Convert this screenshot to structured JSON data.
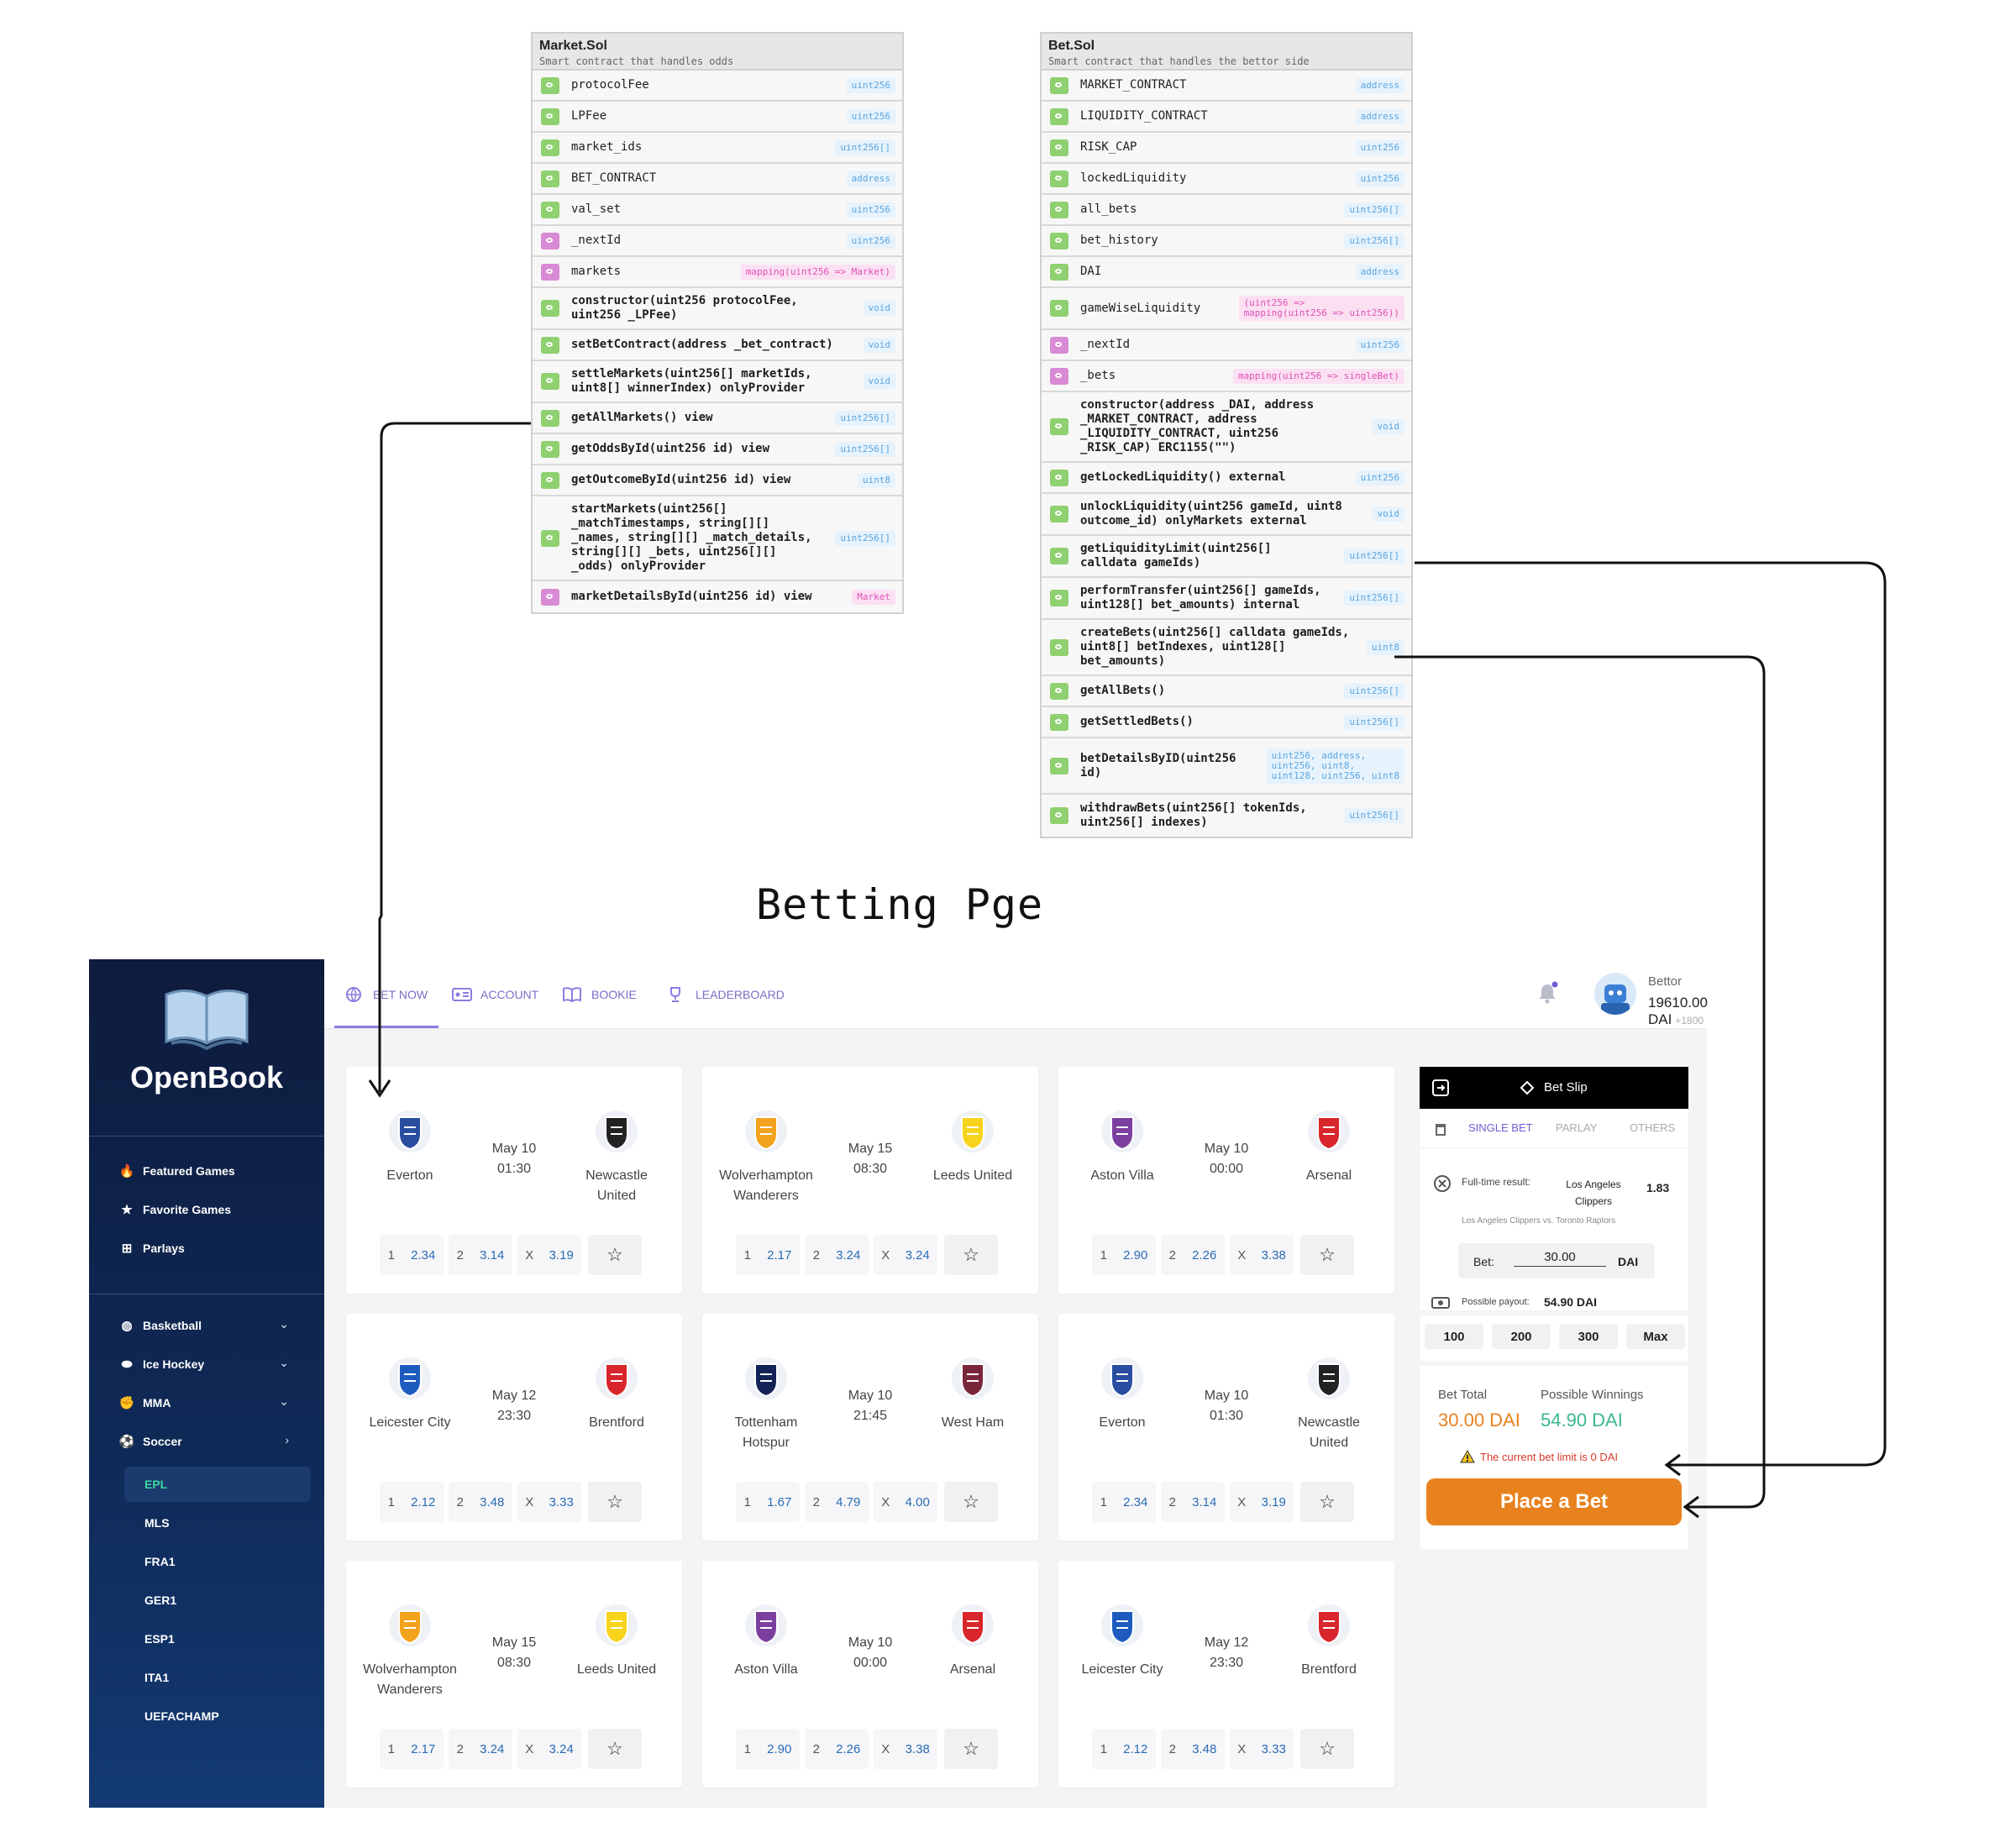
{
  "market_contract": {
    "title": "Market.Sol",
    "subtitle": "Smart contract that handles odds",
    "rows": [
      {
        "name": "protocolFee",
        "type": "uint256",
        "vis": "pub",
        "fn": false
      },
      {
        "name": "LPFee",
        "type": "uint256",
        "vis": "pub",
        "fn": false
      },
      {
        "name": "market_ids",
        "type": "uint256[]",
        "vis": "pub",
        "fn": false
      },
      {
        "name": "BET_CONTRACT",
        "type": "address",
        "vis": "pub",
        "fn": false
      },
      {
        "name": "val_set",
        "type": "uint256",
        "vis": "pub",
        "fn": false
      },
      {
        "name": "_nextId",
        "type": "uint256",
        "vis": "priv",
        "fn": false
      },
      {
        "name": "markets",
        "type": "mapping(uint256 => Market)",
        "vis": "priv",
        "fn": false,
        "map": true
      },
      {
        "name": "constructor(uint256 protocolFee,\nuint256 _LPFee)",
        "type": "void",
        "vis": "pub",
        "fn": true
      },
      {
        "name": "setBetContract(address _bet_contract)",
        "type": "void",
        "vis": "pub",
        "fn": true
      },
      {
        "name": "settleMarkets(uint256[] marketIds,\nuint8[] winnerIndex) onlyProvider",
        "type": "void",
        "vis": "pub",
        "fn": true
      },
      {
        "name": "getAllMarkets() view",
        "type": "uint256[]",
        "vis": "pub",
        "fn": true
      },
      {
        "name": "getOddsById(uint256 id) view",
        "type": "uint256[]",
        "vis": "pub",
        "fn": true
      },
      {
        "name": "getOutcomeById(uint256 id) view",
        "type": "uint8",
        "vis": "pub",
        "fn": true
      },
      {
        "name": "startMarkets(uint256[]\n_matchTimestamps, string[][]\n_names, string[][] _match_details,\nstring[][] _bets, uint256[][]\n_odds) onlyProvider",
        "type": "uint256[]",
        "vis": "pub",
        "fn": true
      },
      {
        "name": "marketDetailsById(uint256 id) view",
        "type": "Market",
        "vis": "priv",
        "fn": true,
        "map": true
      }
    ]
  },
  "bet_contract": {
    "title": "Bet.Sol",
    "subtitle": "Smart contract that handles the bettor side",
    "rows": [
      {
        "name": "MARKET_CONTRACT",
        "type": "address",
        "vis": "pub",
        "fn": false
      },
      {
        "name": "LIQUIDITY_CONTRACT",
        "type": "address",
        "vis": "pub",
        "fn": false
      },
      {
        "name": "RISK_CAP",
        "type": "uint256",
        "vis": "pub",
        "fn": false
      },
      {
        "name": "lockedLiquidity",
        "type": "uint256",
        "vis": "pub",
        "fn": false
      },
      {
        "name": "all_bets",
        "type": "uint256[]",
        "vis": "pub",
        "fn": false
      },
      {
        "name": "bet_history",
        "type": "uint256[]",
        "vis": "pub",
        "fn": false
      },
      {
        "name": "DAI",
        "type": "address",
        "vis": "pub",
        "fn": false
      },
      {
        "name": "gameWiseLiquidity",
        "type": "(uint256 =>\nmapping(uint256 => uint256))",
        "vis": "pub",
        "fn": false,
        "map": true
      },
      {
        "name": "_nextId",
        "type": "uint256",
        "vis": "priv",
        "fn": false
      },
      {
        "name": "_bets",
        "type": "mapping(uint256 => singleBet)",
        "vis": "priv",
        "fn": false,
        "map": true
      },
      {
        "name": "constructor(address _DAI, address\n_MARKET_CONTRACT, address\n_LIQUIDITY_CONTRACT, uint256\n_RISK_CAP) ERC1155(\"\")",
        "type": "void",
        "vis": "pub",
        "fn": true
      },
      {
        "name": "getLockedLiquidity() external",
        "type": "uint256",
        "vis": "pub",
        "fn": true
      },
      {
        "name": "unlockLiquidity(uint256 gameId, uint8\noutcome_id) onlyMarkets external",
        "type": "void",
        "vis": "pub",
        "fn": true
      },
      {
        "name": "getLiquidityLimit(uint256[]\ncalldata gameIds)",
        "type": "uint256[]",
        "vis": "pub",
        "fn": true
      },
      {
        "name": "performTransfer(uint256[] gameIds,\nuint128[] bet_amounts) internal",
        "type": "uint256[]",
        "vis": "pub",
        "fn": true
      },
      {
        "name": "createBets(uint256[] calldata gameIds,\nuint8[] betIndexes, uint128[]\nbet_amounts)",
        "type": "uint8",
        "vis": "pub",
        "fn": true
      },
      {
        "name": "getAllBets()",
        "type": "uint256[]",
        "vis": "pub",
        "fn": true
      },
      {
        "name": "getSettledBets()",
        "type": "uint256[]",
        "vis": "pub",
        "fn": true
      },
      {
        "name": "betDetailsByID(uint256\nid)",
        "type": "uint256, address,\nuint256, uint8,\nuint128, uint256, uint8",
        "vis": "pub",
        "fn": true
      },
      {
        "name": "withdrawBets(uint256[] tokenIds,\nuint256[] indexes)",
        "type": "uint256[]",
        "vis": "pub",
        "fn": true
      }
    ]
  },
  "page_title": "Betting Pge",
  "app": {
    "brand": "OpenBook",
    "sidebar": {
      "top_items": [
        {
          "label": "Featured Games",
          "icon": "flame-icon"
        },
        {
          "label": "Favorite Games",
          "icon": "star-icon"
        },
        {
          "label": "Parlays",
          "icon": "grid-icon"
        }
      ],
      "sports": [
        {
          "label": "Basketball",
          "icon": "basketball-icon",
          "chevron": "⌄"
        },
        {
          "label": "Ice Hockey",
          "icon": "puck-icon",
          "chevron": "⌄"
        },
        {
          "label": "MMA",
          "icon": "glove-icon",
          "chevron": "⌄"
        },
        {
          "label": "Soccer",
          "icon": "soccer-ball-icon",
          "chevron": "›"
        }
      ],
      "leagues": [
        "EPL",
        "MLS",
        "FRA1",
        "GER1",
        "ESP1",
        "ITA1",
        "UEFACHAMP"
      ],
      "active_league": "EPL"
    },
    "tabs": [
      {
        "label": "BET NOW",
        "icon": "globe-icon"
      },
      {
        "label": "ACCOUNT",
        "icon": "id-card-icon"
      },
      {
        "label": "BOOKIE",
        "icon": "book-icon"
      },
      {
        "label": "LEADERBOARD",
        "icon": "trophy-icon"
      }
    ],
    "account": {
      "label": "Bettor",
      "balance": "19610.00 DAI",
      "delta": "+1800"
    },
    "matches": [
      {
        "home": "Everton",
        "away": "Newcastle\nUnited",
        "date": "May 10",
        "time": "01:30",
        "o1": "2.34",
        "o2": "3.14",
        "ox": "3.19",
        "home_crest": "#2a4da0",
        "away_crest": "#222222"
      },
      {
        "home": "Wolverhampton\nWanderers",
        "away": "Leeds United",
        "date": "May 15",
        "time": "08:30",
        "o1": "2.17",
        "o2": "3.24",
        "ox": "3.24",
        "home_crest": "#f2a21c",
        "away_crest": "#f7d31c"
      },
      {
        "home": "Aston Villa",
        "away": "Arsenal",
        "date": "May 10",
        "time": "00:00",
        "o1": "2.90",
        "o2": "2.26",
        "ox": "3.38",
        "home_crest": "#7b3fa0",
        "away_crest": "#d8262c"
      },
      {
        "home": "Leicester City",
        "away": "Brentford",
        "date": "May 12",
        "time": "23:30",
        "o1": "2.12",
        "o2": "3.48",
        "ox": "3.33",
        "home_crest": "#1d5bbf",
        "away_crest": "#d8262c"
      },
      {
        "home": "Tottenham\nHotspur",
        "away": "West Ham",
        "date": "May 10",
        "time": "21:45",
        "o1": "1.67",
        "o2": "4.79",
        "ox": "4.00",
        "home_crest": "#132257",
        "away_crest": "#7a263a"
      },
      {
        "home": "Everton",
        "away": "Newcastle\nUnited",
        "date": "May 10",
        "time": "01:30",
        "o1": "2.34",
        "o2": "3.14",
        "ox": "3.19",
        "home_crest": "#2a4da0",
        "away_crest": "#222222"
      },
      {
        "home": "Wolverhampton\nWanderers",
        "away": "Leeds United",
        "date": "May 15",
        "time": "08:30",
        "o1": "2.17",
        "o2": "3.24",
        "ox": "3.24",
        "home_crest": "#f2a21c",
        "away_crest": "#f7d31c"
      },
      {
        "home": "Aston Villa",
        "away": "Arsenal",
        "date": "May 10",
        "time": "00:00",
        "o1": "2.90",
        "o2": "2.26",
        "ox": "3.38",
        "home_crest": "#7b3fa0",
        "away_crest": "#d8262c"
      },
      {
        "home": "Leicester City",
        "away": "Brentford",
        "date": "May 12",
        "time": "23:30",
        "o1": "2.12",
        "o2": "3.48",
        "ox": "3.33",
        "home_crest": "#1d5bbf",
        "away_crest": "#d8262c"
      }
    ],
    "odds_labels": {
      "one": "1",
      "two": "2",
      "x": "X"
    },
    "betslip": {
      "title": "Bet Slip",
      "tabs": [
        "SINGLE BET",
        "PARLAY",
        "OTHERS"
      ],
      "result_label": "Full-time result:",
      "pick": "Los Angeles\nClippers",
      "odds": "1.83",
      "matchup": "Los Angeles Clippers vs. Toronto Raptors",
      "bet_label": "Bet:",
      "bet_value": "30.00",
      "currency": "DAI",
      "payout_label": "Possible payout:",
      "payout_value": "54.90 DAI",
      "quick": [
        "100",
        "200",
        "300",
        "Max"
      ],
      "total_label": "Bet Total",
      "total_value": "30.00 DAI",
      "win_label": "Possible Winnings",
      "win_value": "54.90 DAI",
      "warning": "The current bet limit is 0 DAI",
      "place": "Place a Bet"
    },
    "colors": {
      "accent": "#e8821e",
      "sidebar": "#0f2a58",
      "active_league": "#3ed9a0",
      "tab": "#7a6fc6",
      "total": "#e8821e",
      "winnings": "#3cb88a",
      "warning": "#d83a2a"
    }
  }
}
